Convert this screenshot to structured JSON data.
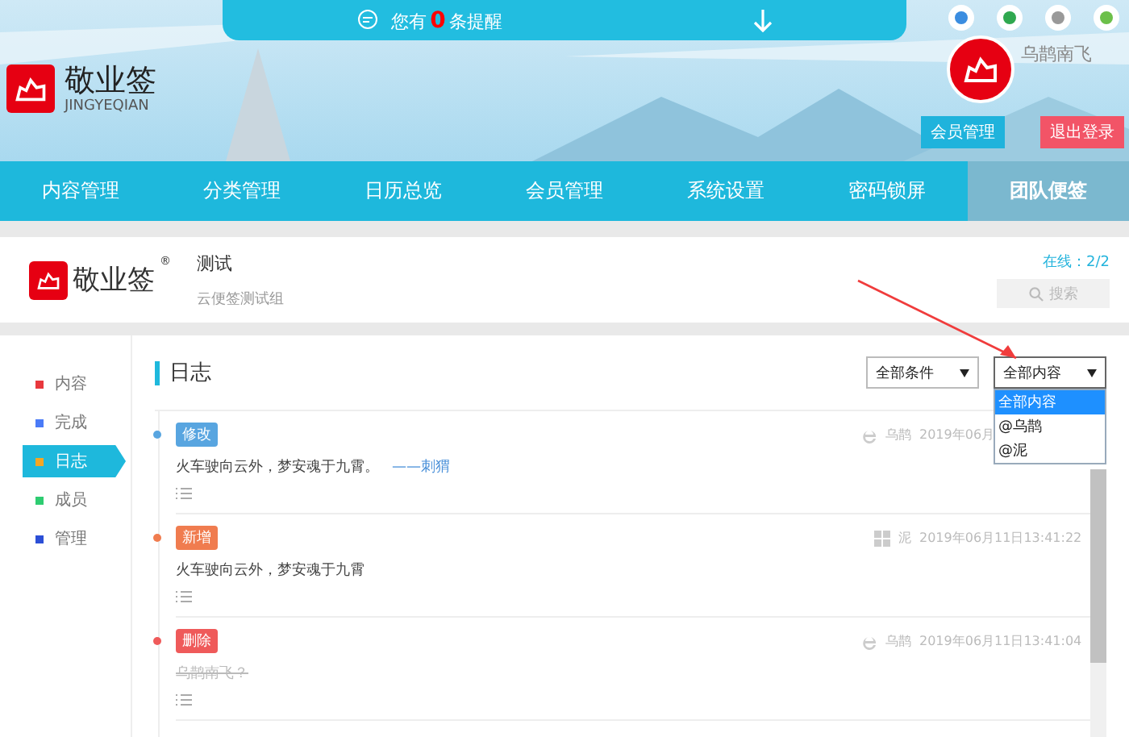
{
  "notice": {
    "prefix": "您有",
    "count": "0",
    "suffix": "条提醒"
  },
  "brand": {
    "name": "敬业签",
    "latin": "JINGYEQIAN"
  },
  "user": {
    "name": "乌鹊南飞",
    "buttons": [
      "会员管理",
      "退出登录"
    ]
  },
  "nav": [
    {
      "label": "内容管理",
      "selected": false
    },
    {
      "label": "分类管理",
      "selected": false
    },
    {
      "label": "日历总览",
      "selected": false
    },
    {
      "label": "会员管理",
      "selected": false
    },
    {
      "label": "系统设置",
      "selected": false
    },
    {
      "label": "密码锁屏",
      "selected": false
    },
    {
      "label": "团队便签",
      "selected": true
    }
  ],
  "group": {
    "brand": "敬业签",
    "registered_mark": "®",
    "name": "测试",
    "description": "云便签测试组",
    "online_label": "在线：",
    "online": "2/2",
    "search": "搜索"
  },
  "sidebar": [
    {
      "label": "内容",
      "selected": false,
      "color": "#e8383d"
    },
    {
      "label": "完成",
      "selected": false,
      "color": "#4a7bf7"
    },
    {
      "label": "日志",
      "selected": true,
      "color": "#f5a623"
    },
    {
      "label": "成员",
      "selected": false,
      "color": "#2ecc71"
    },
    {
      "label": "管理",
      "selected": false,
      "color": "#2c4fd6"
    }
  ],
  "log": {
    "title": "日志",
    "filters": [
      {
        "value": "全部条件",
        "expanded": false
      },
      {
        "value": "全部内容",
        "expanded": true,
        "options": [
          {
            "label": "全部内容",
            "selected": true
          },
          {
            "label": "@乌鹊",
            "selected": false
          },
          {
            "label": "@泥",
            "selected": false
          }
        ]
      }
    ],
    "entries": [
      {
        "kind": "modify",
        "tag": "修改",
        "text": "火车驶向云外，梦安魂于九霄。",
        "signature": "——刺猬",
        "author": "乌鹊",
        "time": "2019年06月"
      },
      {
        "kind": "add",
        "tag": "新增",
        "text": "火车驶向云外，梦安魂于九霄",
        "author": "泥",
        "time": "2019年06月11日13:41:22"
      },
      {
        "kind": "delete",
        "tag": "删除",
        "text": "乌鹊南飞？",
        "author": "乌鹊",
        "time": "2019年06月11日13:41:04"
      }
    ]
  }
}
